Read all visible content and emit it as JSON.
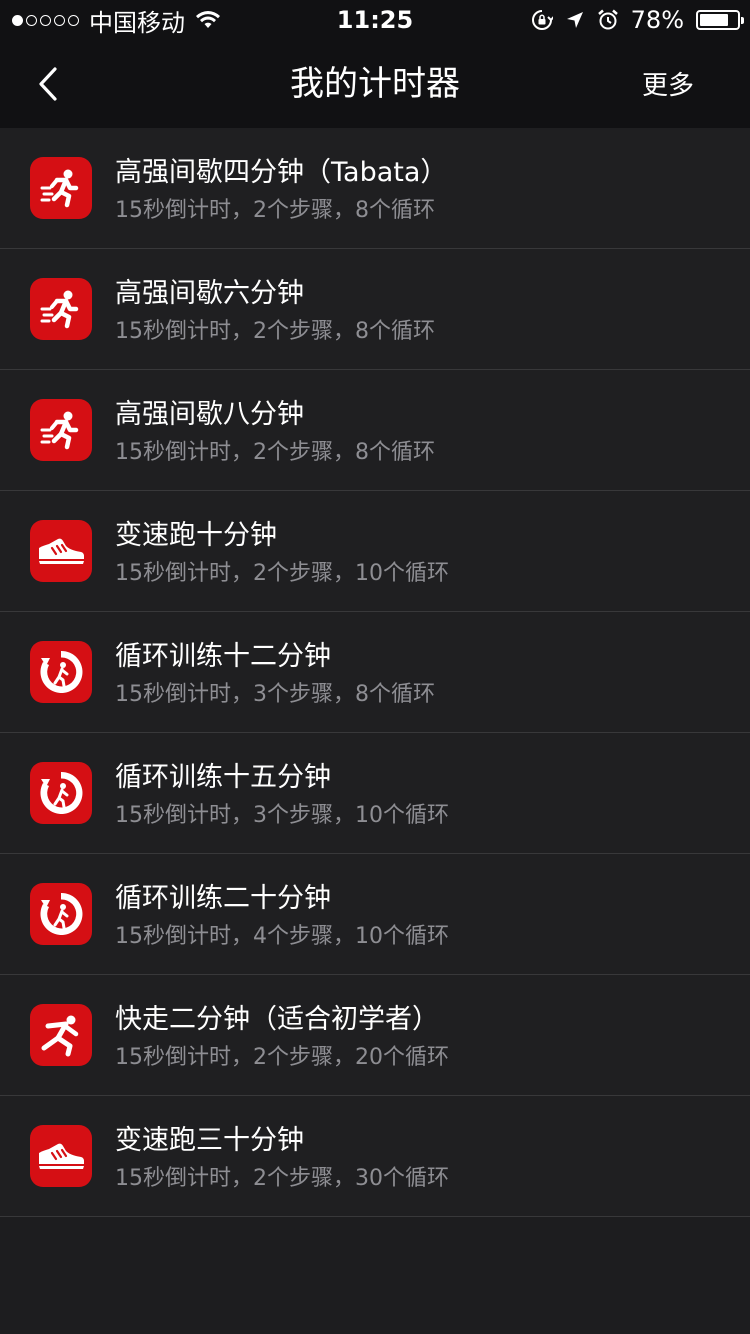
{
  "status_bar": {
    "carrier": "中国移动",
    "time": "11:25",
    "battery_percent": "78%",
    "battery_level": 0.78,
    "signal_bars_filled": 1,
    "signal_bars_total": 5
  },
  "nav": {
    "title": "我的计时器",
    "more_label": "更多"
  },
  "colors": {
    "accent": "#d50f14",
    "background": "#1f1f21",
    "subtitle": "#8e8e93"
  },
  "timers": [
    {
      "icon": "running-person-icon",
      "title": "高强间歇四分钟（Tabata）",
      "subtitle": "15秒倒计时，2个步骤，8个循环"
    },
    {
      "icon": "running-person-icon",
      "title": "高强间歇六分钟",
      "subtitle": "15秒倒计时，2个步骤，8个循环"
    },
    {
      "icon": "running-person-icon",
      "title": "高强间歇八分钟",
      "subtitle": "15秒倒计时，2个步骤，8个循环"
    },
    {
      "icon": "running-shoe-icon",
      "title": "变速跑十分钟",
      "subtitle": "15秒倒计时，2个步骤，10个循环"
    },
    {
      "icon": "circuit-training-icon",
      "title": "循环训练十二分钟",
      "subtitle": "15秒倒计时，3个步骤，8个循环"
    },
    {
      "icon": "circuit-training-icon",
      "title": "循环训练十五分钟",
      "subtitle": "15秒倒计时，3个步骤，10个循环"
    },
    {
      "icon": "circuit-training-icon",
      "title": "循环训练二十分钟",
      "subtitle": "15秒倒计时，4个步骤，10个循环"
    },
    {
      "icon": "walking-person-icon",
      "title": "快走二分钟（适合初学者）",
      "subtitle": "15秒倒计时，2个步骤，20个循环"
    },
    {
      "icon": "running-shoe-icon",
      "title": "变速跑三十分钟",
      "subtitle": "15秒倒计时，2个步骤，30个循环"
    }
  ]
}
